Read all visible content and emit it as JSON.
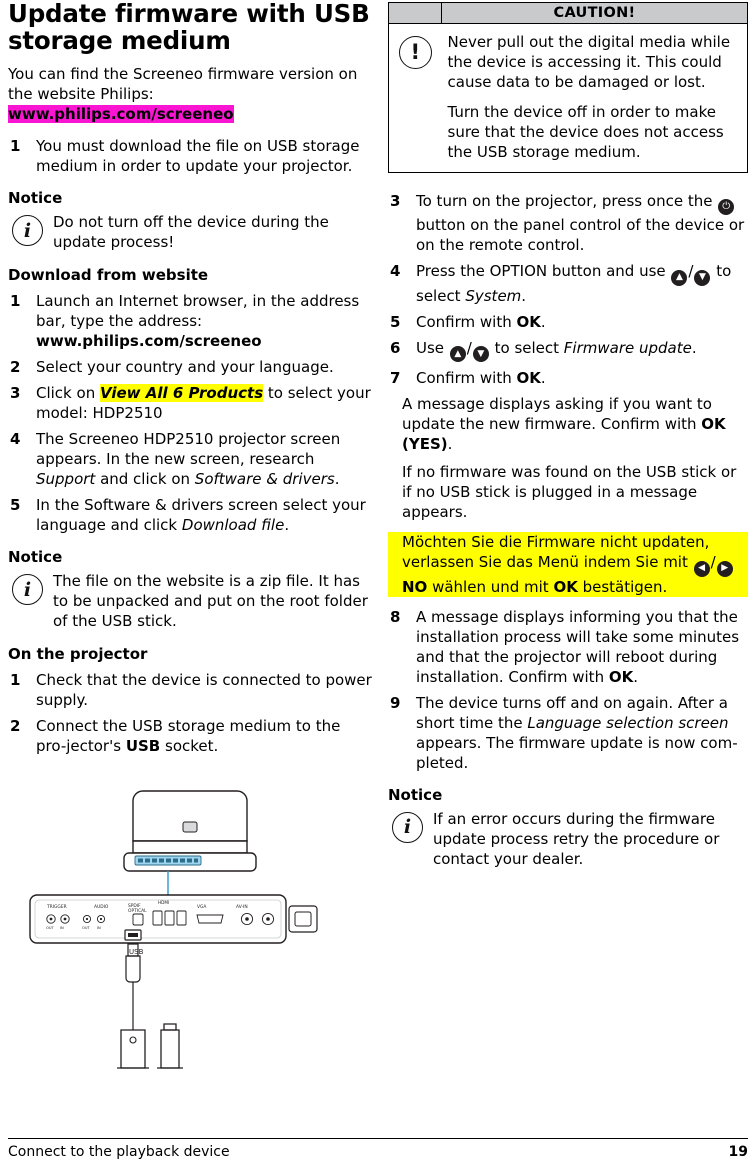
{
  "left": {
    "title": "Update firmware with USB storage medium",
    "intro_pre": "You can find the Screeneo firmware version on the website Philips: ",
    "intro_url": "www.philips.com/screeneo",
    "steps_top": [
      {
        "num": "1",
        "text": "You must download the file on USB storage medium in order to update your projector."
      }
    ],
    "notice1_heading": "Notice",
    "notice1_text": "Do not turn off the device during the update process!",
    "download_heading": "Download from website",
    "download_steps": [
      {
        "num": "1",
        "pre": "Launch an Internet browser, in the address bar, type the address: ",
        "bold": "www.philips.com/screeneo",
        "post": ""
      },
      {
        "num": "2",
        "pre": "Select your country and your language.",
        "bold": "",
        "post": ""
      },
      {
        "num": "3",
        "pre": "Click on ",
        "hl_italic": "View All 6 Products",
        "post": " to select your model: HDP2510"
      },
      {
        "num": "4",
        "pre": "The Screeneo HDP2510 projector screen appears. In the new screen, research ",
        "italic1": "Support",
        "mid": " and click on ",
        "italic2": "Software & drivers",
        "post": "."
      },
      {
        "num": "5",
        "pre": "In the Software & drivers screen select your language and click ",
        "italic1": "Download file",
        "post": "."
      }
    ],
    "notice2_heading": "Notice",
    "notice2_text": "The file on the website is a zip file. It has to be unpacked and put on the root folder of the USB stick.",
    "projector_heading": "On the projector",
    "projector_steps": [
      {
        "num": "1",
        "pre": "Check that the device is connected to power supply.",
        "bold": "",
        "post": ""
      },
      {
        "num": "2",
        "pre": "Connect the USB storage medium to the pro-jector's ",
        "bold": "USB",
        "post": " socket."
      }
    ],
    "figure_labels": {
      "trigger": "TRIGGER",
      "audio": "AUDIO",
      "spdif": "SPDIF",
      "hdmi": "HDMI",
      "vga": "VGA",
      "av": "AV-IN"
    }
  },
  "right": {
    "caution": {
      "header": "CAUTION!",
      "icon": "exclamation-icon",
      "paragraphs": [
        "Never pull out the digital media while the device is accessing it. This could cause data to be damaged or lost.",
        "Turn the device off in order to make sure that the device does not access the USB storage medium."
      ]
    },
    "steps": [
      {
        "num": "3",
        "pre": "To turn on the projector, press once the ",
        "key": "power-key",
        "post": " button on the panel control of the device or on the remote control."
      },
      {
        "num": "4",
        "pre": "Press the OPTION button and use ",
        "key1": "up-key",
        "sep": "/",
        "key2": "down-key",
        "mid": " to ",
        "post_italic": "",
        "post": "select ",
        "italic": "System",
        "tail": "."
      },
      {
        "num": "5",
        "pre": "Confirm with ",
        "bold": "OK",
        "post": "."
      },
      {
        "num": "6",
        "pre": "Use ",
        "key1": "up-key",
        "sep": "/",
        "key2": "down-key",
        "post": " to select ",
        "italic": "Firmware update",
        "tail": "."
      },
      {
        "num": "7",
        "pre": "Confirm with ",
        "bold": "OK",
        "post": "."
      }
    ],
    "msg1_pre": "A message displays asking if you want to update the new firmware. Confirm with ",
    "msg1_bold": "OK (YES)",
    "msg1_post": ".",
    "msg2": "If no firmware was found on the USB stick or if no USB stick is plugged in a message appears.",
    "yellow_msg": {
      "line1": "Möchten Sie die Firmware nicht updaten, verlassen Sie das Menü indem Sie mit ",
      "key_left": "left-key",
      "sep": "/",
      "key_right": "right-key",
      "line2_bold1": "NO",
      "line2_mid": " wählen und mit ",
      "line2_bold2": "OK",
      "line2_end": " bestätigen."
    },
    "steps2": [
      {
        "num": "8",
        "pre": "A message displays informing you that the installation process will take some minutes and that the projector will reboot during installation. Confirm with ",
        "bold": "OK",
        "post": "."
      },
      {
        "num": "9",
        "pre": "The device turns off and on again. After a short time the ",
        "italic": "Language selection screen",
        "mid": " appears. The firmware update is now com-pleted.",
        "post": ""
      }
    ],
    "notice_heading": "Notice",
    "notice_text": "If an error occurs during the firmware update process retry the procedure or contact your dealer."
  },
  "footer": {
    "left": "Connect to the playback device",
    "right": "19"
  }
}
